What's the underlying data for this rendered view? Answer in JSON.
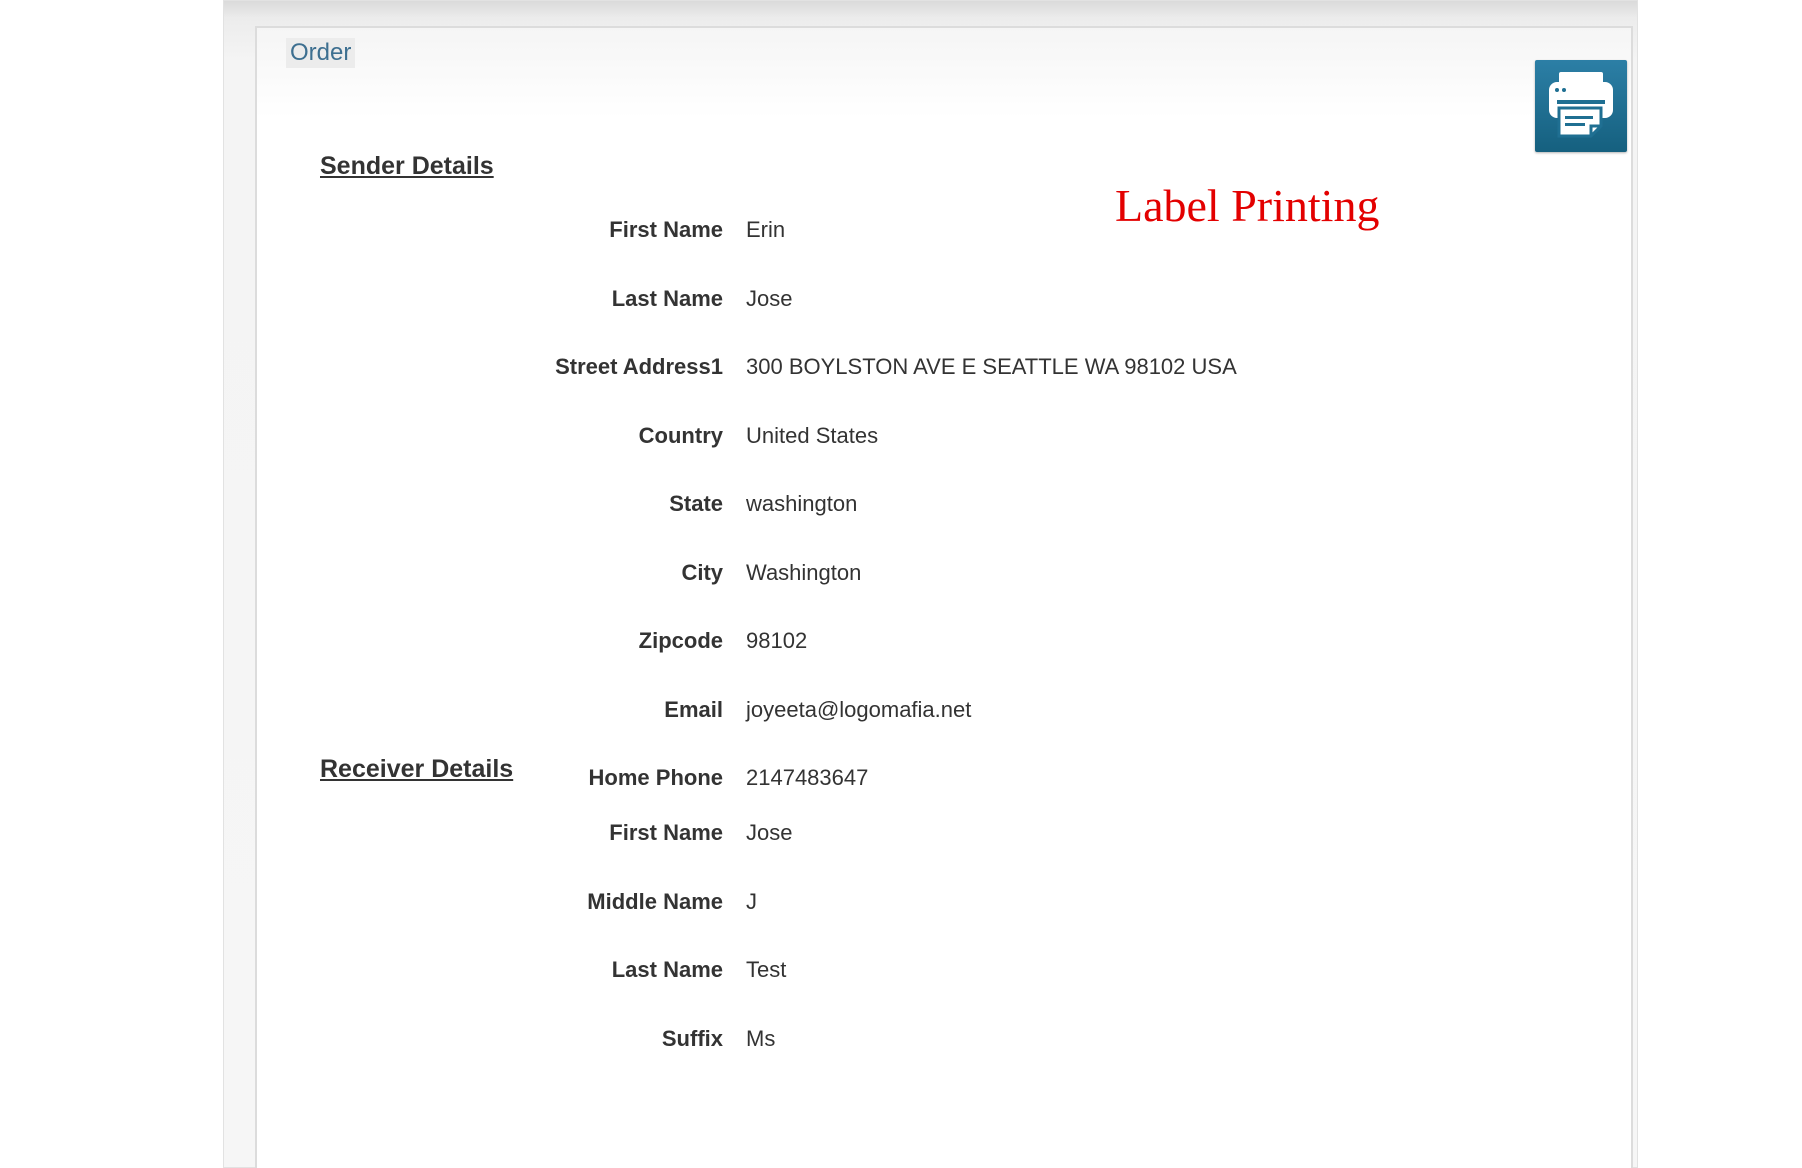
{
  "order": {
    "legend": "Order"
  },
  "overlay": {
    "caption": "Label Printing",
    "color": "#e30000"
  },
  "print_button": {
    "icon": "printer-icon",
    "color": "#1f6f92"
  },
  "sender": {
    "title": "Sender Details",
    "fields": [
      {
        "label": "First Name",
        "value": "Erin"
      },
      {
        "label": "Last Name",
        "value": "Jose"
      },
      {
        "label": "Street Address1",
        "value": "300 BOYLSTON AVE E SEATTLE WA 98102 USA"
      },
      {
        "label": "Country",
        "value": "United States"
      },
      {
        "label": "State",
        "value": "washington"
      },
      {
        "label": "City",
        "value": "Washington"
      },
      {
        "label": "Zipcode",
        "value": "98102"
      },
      {
        "label": "Email",
        "value": "joyeeta@logomafia.net"
      },
      {
        "label": "Home Phone",
        "value": "2147483647"
      }
    ]
  },
  "receiver": {
    "title": "Receiver Details",
    "fields": [
      {
        "label": "First Name",
        "value": "Jose"
      },
      {
        "label": "Middle Name",
        "value": "J"
      },
      {
        "label": "Last Name",
        "value": "Test"
      },
      {
        "label": "Suffix",
        "value": "Ms"
      }
    ]
  }
}
